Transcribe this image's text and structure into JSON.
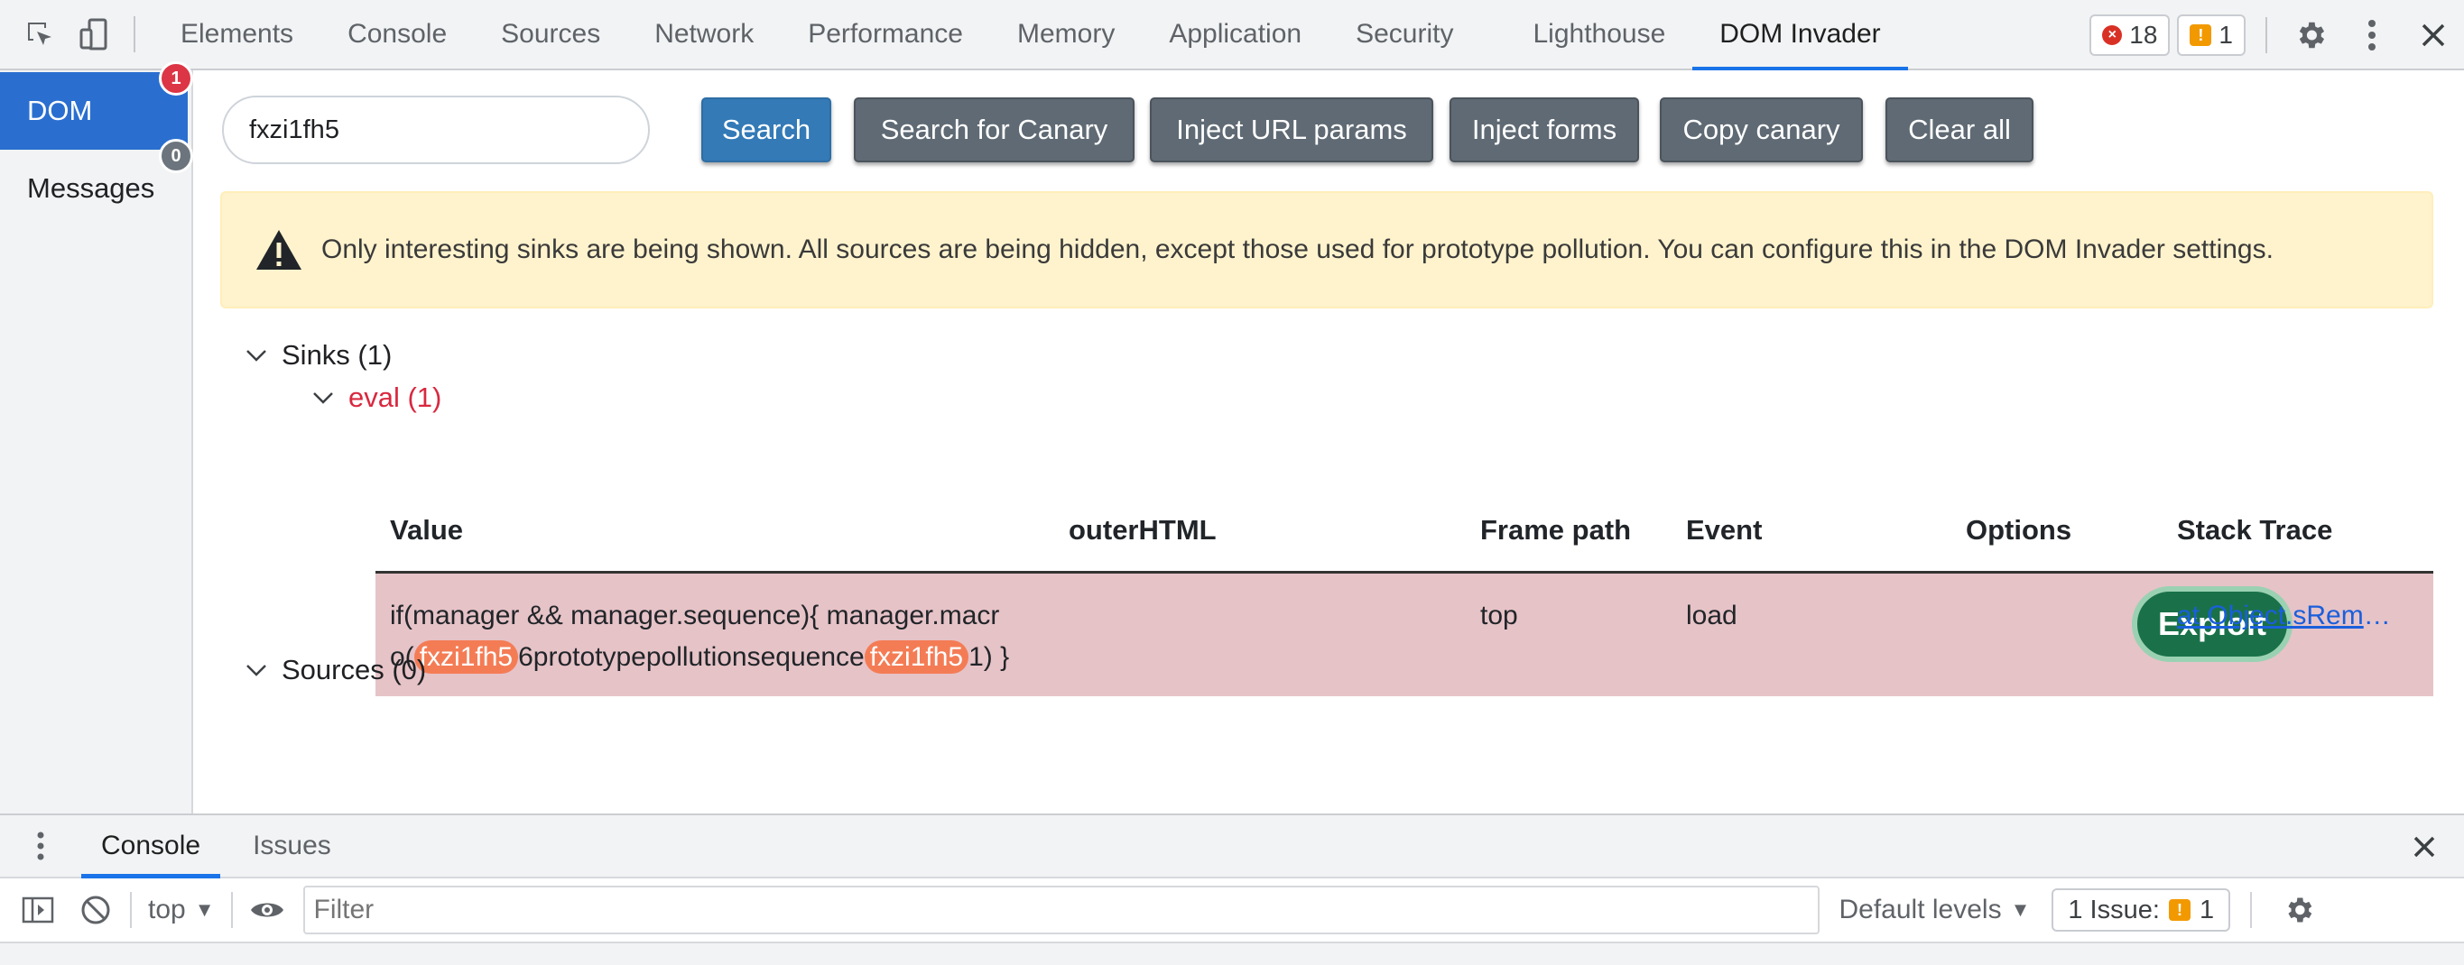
{
  "devtools": {
    "tabs": [
      "Elements",
      "Console",
      "Sources",
      "Network",
      "Performance",
      "Memory",
      "Application",
      "Security",
      "Lighthouse",
      "DOM Invader"
    ],
    "active_tab": "DOM Invader",
    "error_count": "18",
    "warning_count": "1",
    "icons": {
      "inspect": "inspect-element-icon",
      "device": "device-toolbar-icon",
      "settings": "gear-icon",
      "more": "kebab-menu-icon",
      "close": "close-icon"
    }
  },
  "sidebar": {
    "items": [
      {
        "label": "DOM",
        "badge": "1",
        "badge_color": "#dc3545",
        "active": true
      },
      {
        "label": "Messages",
        "badge": "0",
        "badge_color": "#6c757d",
        "active": false
      }
    ]
  },
  "toolbar": {
    "search_value": "fxzi1fh5",
    "search_label": "Search",
    "canary_label": "Search for Canary",
    "inject_url_label": "Inject URL params",
    "inject_forms_label": "Inject forms",
    "copy_canary_label": "Copy canary",
    "clear_label": "Clear all"
  },
  "alert": {
    "icon": "warning-triangle-icon",
    "text": "Only interesting sinks are being shown. All sources are being hidden, except those used for prototype pollution. You can configure this in the DOM Invader settings."
  },
  "tree": {
    "sinks_label": "Sinks (1)",
    "eval_label": "eval (1)",
    "sources_label": "Sources (0)"
  },
  "table": {
    "headers": {
      "value": "Value",
      "outer_html": "outerHTML",
      "frame_path": "Frame path",
      "event": "Event",
      "options": "Options",
      "stack_trace": "Stack Trace"
    },
    "rows": [
      {
        "value_line1": "if(manager && manager.sequence){ manager.macr",
        "value_pre": "o(",
        "canary": "fxzi1fh5",
        "value_mid": "6prototypepollutionsequence",
        "value_post": "1) }",
        "outer_html": "",
        "frame_path": "top",
        "event": "load",
        "option_label": "Exploit",
        "stack_trace": "at Object.sRemoveItem"
      }
    ]
  },
  "colors": {
    "accent": "#1a73e8",
    "row_highlight": "#e6c3c7",
    "canary": "#f47c55",
    "exploit": "#1a7149",
    "eval": "#d8283f"
  },
  "drawer": {
    "tabs": [
      "Console",
      "Issues"
    ],
    "active_tab": "Console",
    "context": "top",
    "filter_placeholder": "Filter",
    "levels_label": "Default levels",
    "issues_label": "1 Issue:",
    "issues_count": "1"
  }
}
